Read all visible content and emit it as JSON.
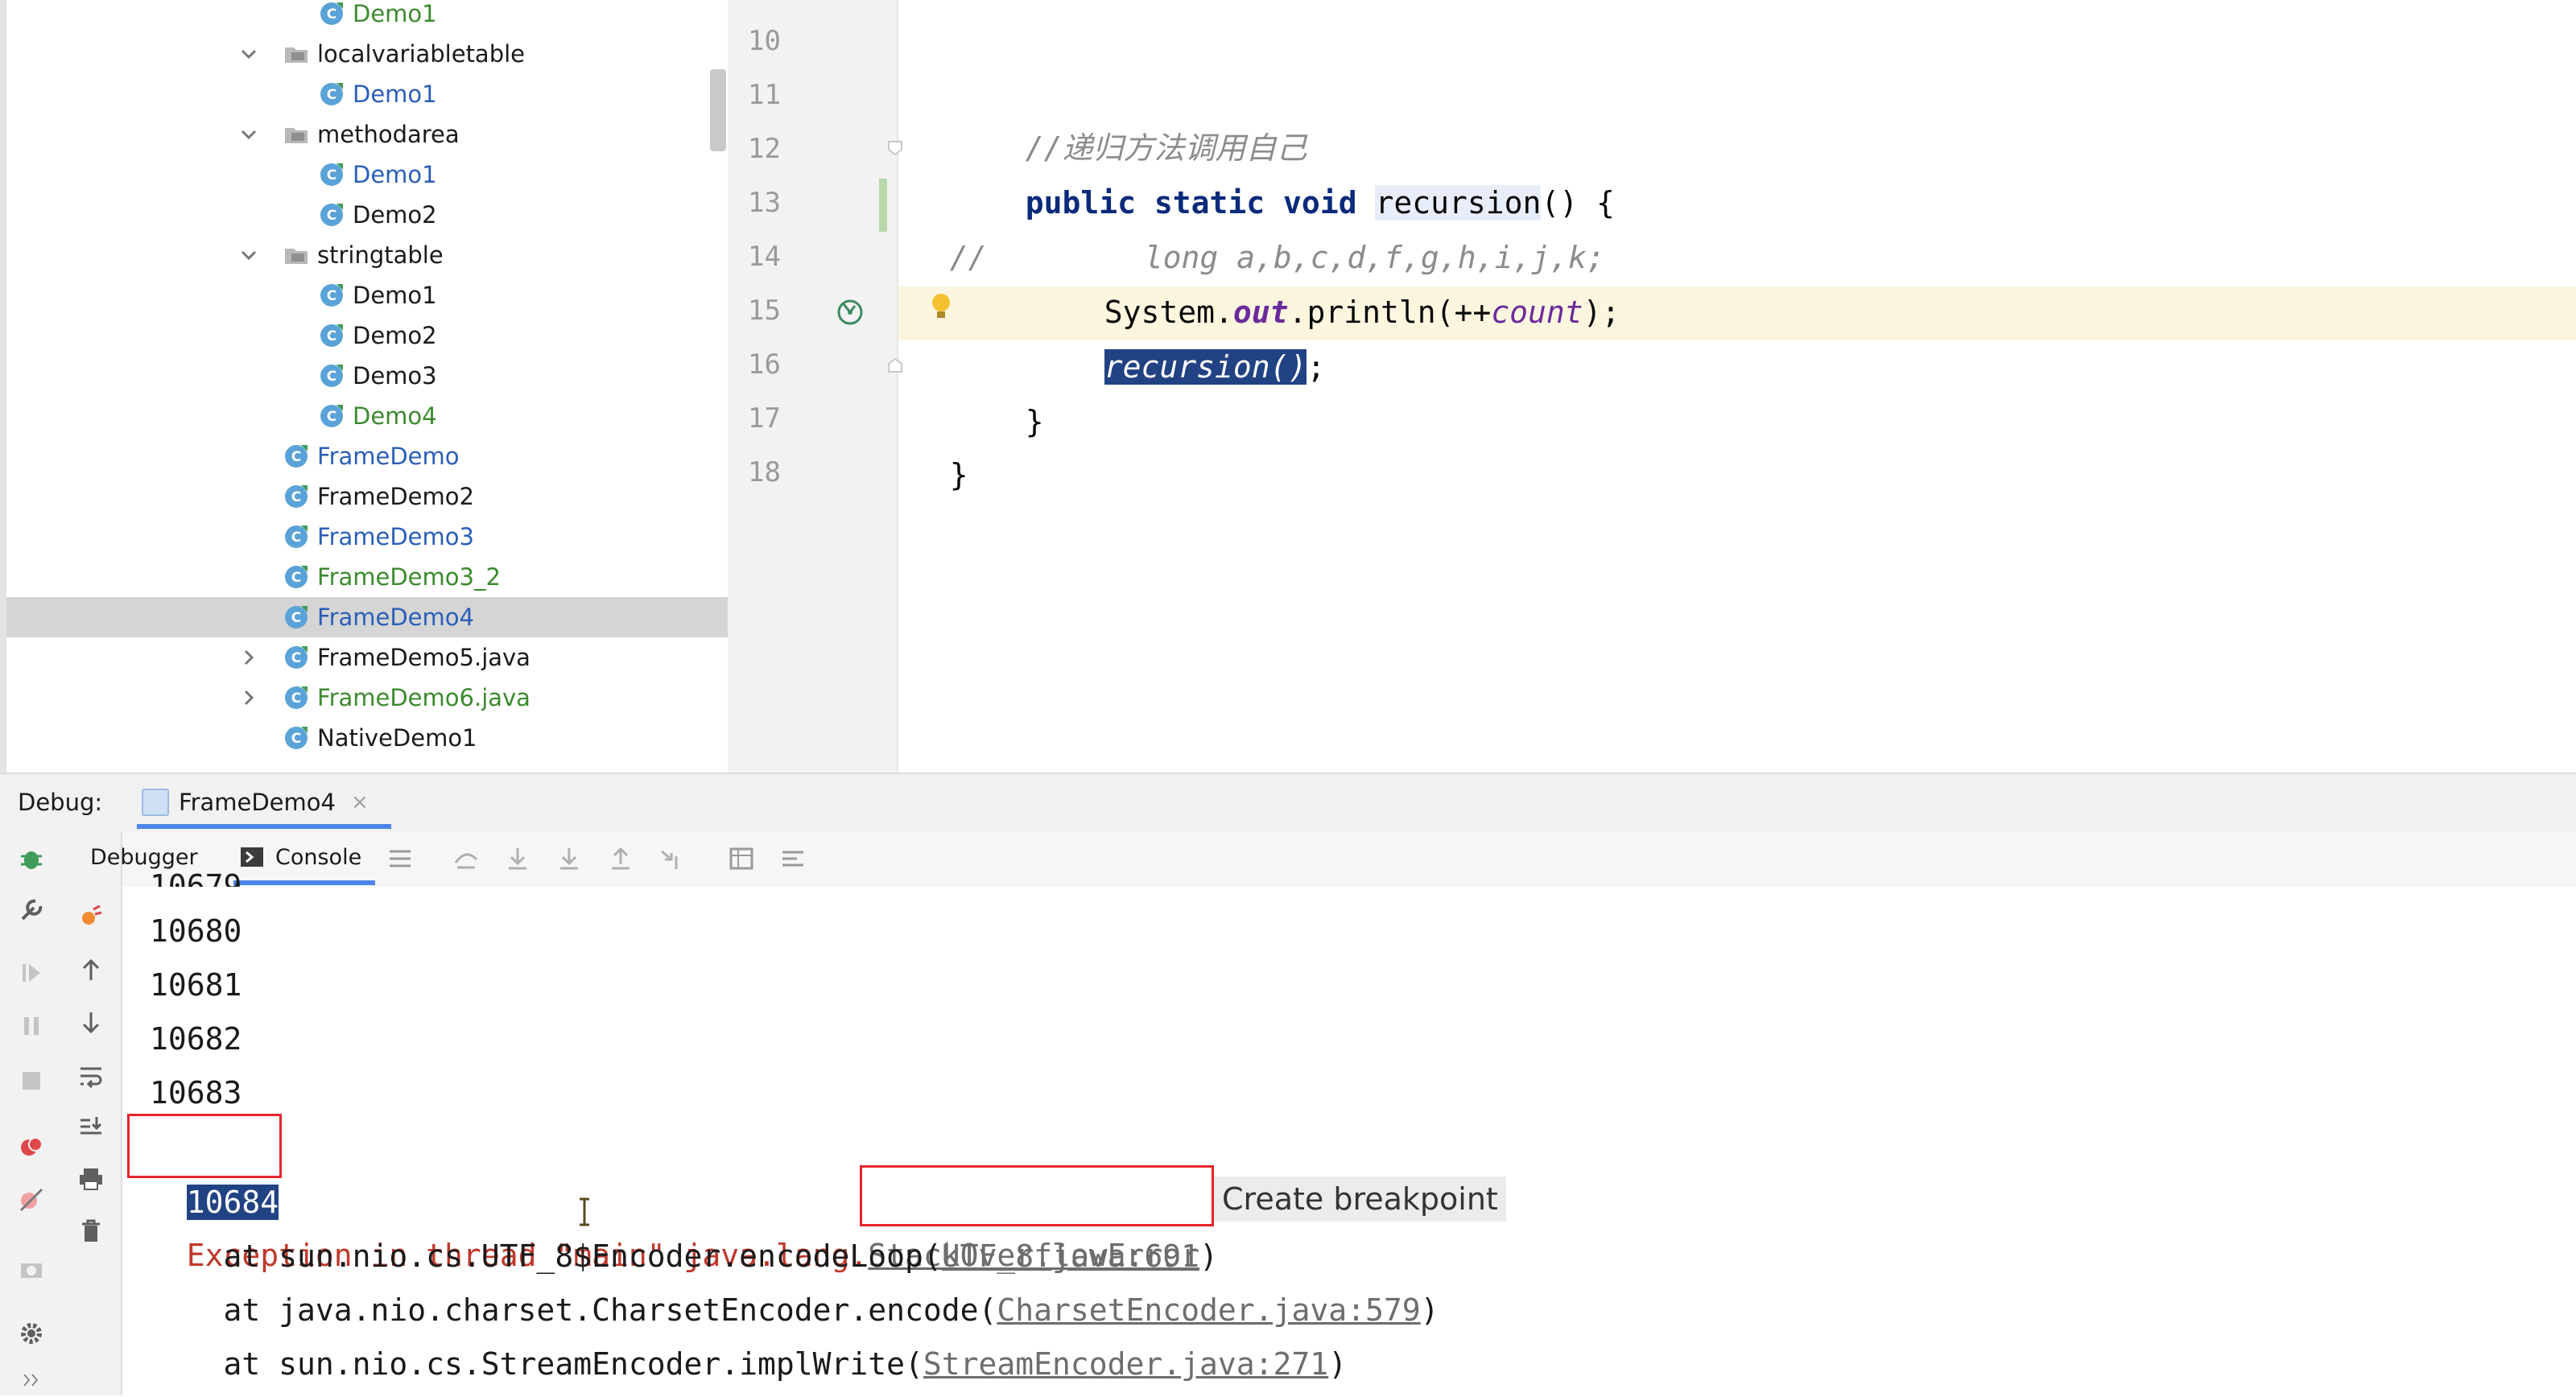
{
  "project_tree": {
    "items": [
      {
        "label": "Demo1",
        "kind": "class",
        "color": "green",
        "expand": "none",
        "indent": 2
      },
      {
        "label": "localvariabletable",
        "kind": "folder",
        "color": "dark",
        "expand": "open",
        "indent": 1
      },
      {
        "label": "Demo1",
        "kind": "class",
        "color": "blue",
        "expand": "none",
        "indent": 2
      },
      {
        "label": "methodarea",
        "kind": "folder",
        "color": "dark",
        "expand": "open",
        "indent": 1
      },
      {
        "label": "Demo1",
        "kind": "class",
        "color": "blue",
        "expand": "none",
        "indent": 2
      },
      {
        "label": "Demo2",
        "kind": "class",
        "color": "dark",
        "expand": "none",
        "indent": 2
      },
      {
        "label": "stringtable",
        "kind": "folder",
        "color": "dark",
        "expand": "open",
        "indent": 1
      },
      {
        "label": "Demo1",
        "kind": "class",
        "color": "dark",
        "expand": "none",
        "indent": 2
      },
      {
        "label": "Demo2",
        "kind": "class",
        "color": "dark",
        "expand": "none",
        "indent": 2
      },
      {
        "label": "Demo3",
        "kind": "class",
        "color": "dark",
        "expand": "none",
        "indent": 2
      },
      {
        "label": "Demo4",
        "kind": "class",
        "color": "green",
        "expand": "none",
        "indent": 2
      },
      {
        "label": "FrameDemo",
        "kind": "class",
        "color": "blue",
        "expand": "none",
        "indent": 1
      },
      {
        "label": "FrameDemo2",
        "kind": "class",
        "color": "dark",
        "expand": "none",
        "indent": 1
      },
      {
        "label": "FrameDemo3",
        "kind": "class",
        "color": "blue",
        "expand": "none",
        "indent": 1
      },
      {
        "label": "FrameDemo3_2",
        "kind": "class",
        "color": "green",
        "expand": "none",
        "indent": 1
      },
      {
        "label": "FrameDemo4",
        "kind": "class",
        "color": "blue",
        "expand": "none",
        "indent": 1,
        "selected": true
      },
      {
        "label": "FrameDemo5.java",
        "kind": "class",
        "color": "dark",
        "expand": "closed",
        "indent": 1
      },
      {
        "label": "FrameDemo6.java",
        "kind": "class",
        "color": "green",
        "expand": "closed",
        "indent": 1
      },
      {
        "label": "NativeDemo1",
        "kind": "class",
        "color": "dark",
        "expand": "none",
        "indent": 1
      }
    ]
  },
  "editor": {
    "line_numbers": [
      "10",
      "11",
      "12",
      "13",
      "14",
      "15",
      "16",
      "17",
      "18"
    ],
    "line11_comment": "//递归方法调用自己",
    "line12": {
      "kw": "public static void ",
      "method": "recursion",
      "rest": "() {"
    },
    "line13": {
      "prefix": "//",
      "comment": "long a,b,c,d,f,g,h,i,j,k;"
    },
    "line14": {
      "a": "System.",
      "field": "out",
      "b": ".println(++",
      "var": "count",
      "c": ");"
    },
    "line15": {
      "selected": "recursion()",
      "rest": ";"
    },
    "line16": "}",
    "line17": "}"
  },
  "debug": {
    "label": "Debug:",
    "tab": "FrameDemo4",
    "tab_close": "×",
    "debugger_tab": "Debugger",
    "console_tab": "Console"
  },
  "console": {
    "numbers": [
      "10680",
      "10681",
      "10682",
      "10683"
    ],
    "selected_number": "10684",
    "exception_prefix": "Exception in thread \"main\" java.lang.",
    "exception_class": "StackOverflowError",
    "create_breakpoint": "Create breakpoint",
    "trace": [
      {
        "text": "    at sun.nio.cs.UTF_8$Encoder.encodeLoop(",
        "link": "UTF_8.java:691",
        "end": ")"
      },
      {
        "text": "    at java.nio.charset.CharsetEncoder.encode(",
        "link": "CharsetEncoder.java:579",
        "end": ")"
      },
      {
        "text": "    at sun.nio.cs.StreamEncoder.implWrite(",
        "link": "StreamEncoder.java:271",
        "end": ")"
      }
    ]
  },
  "colors": {
    "selection": "#214283",
    "accent": "#4a86e8",
    "highlight_box": "#e8262d",
    "current_line": "#fcf6df"
  }
}
